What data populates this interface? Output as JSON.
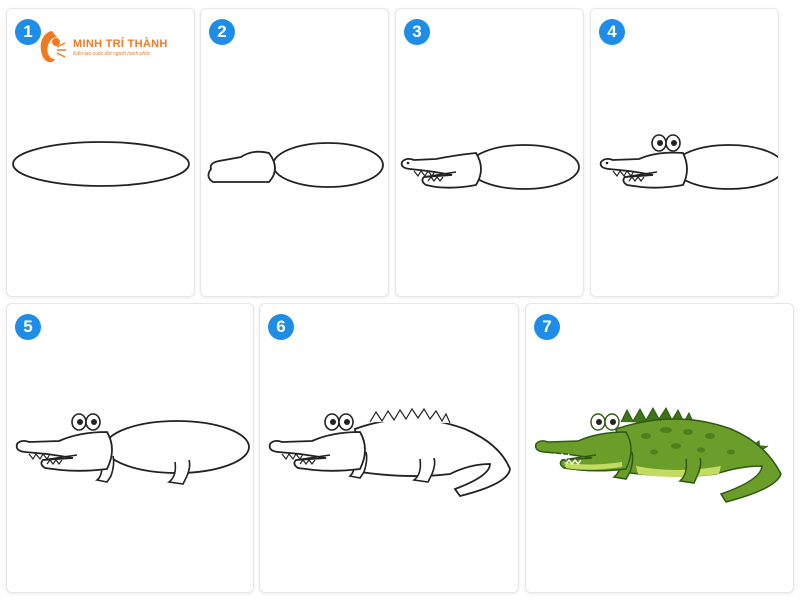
{
  "brand": {
    "name": "MINH TRÍ THÀNH",
    "tagline": "Kiến tạo cuộc đời người hạnh phúc"
  },
  "steps": [
    {
      "number": "1"
    },
    {
      "number": "2"
    },
    {
      "number": "3"
    },
    {
      "number": "4"
    },
    {
      "number": "5"
    },
    {
      "number": "6"
    },
    {
      "number": "7"
    }
  ],
  "colors": {
    "badge": "#1e8de8",
    "brand_orange": "#f07a22",
    "outline": "#222222",
    "croc_green": "#6a9d2a",
    "croc_belly": "#c3da63",
    "croc_spots": "#4f7f1c",
    "croc_spikes": "#3f7418"
  }
}
